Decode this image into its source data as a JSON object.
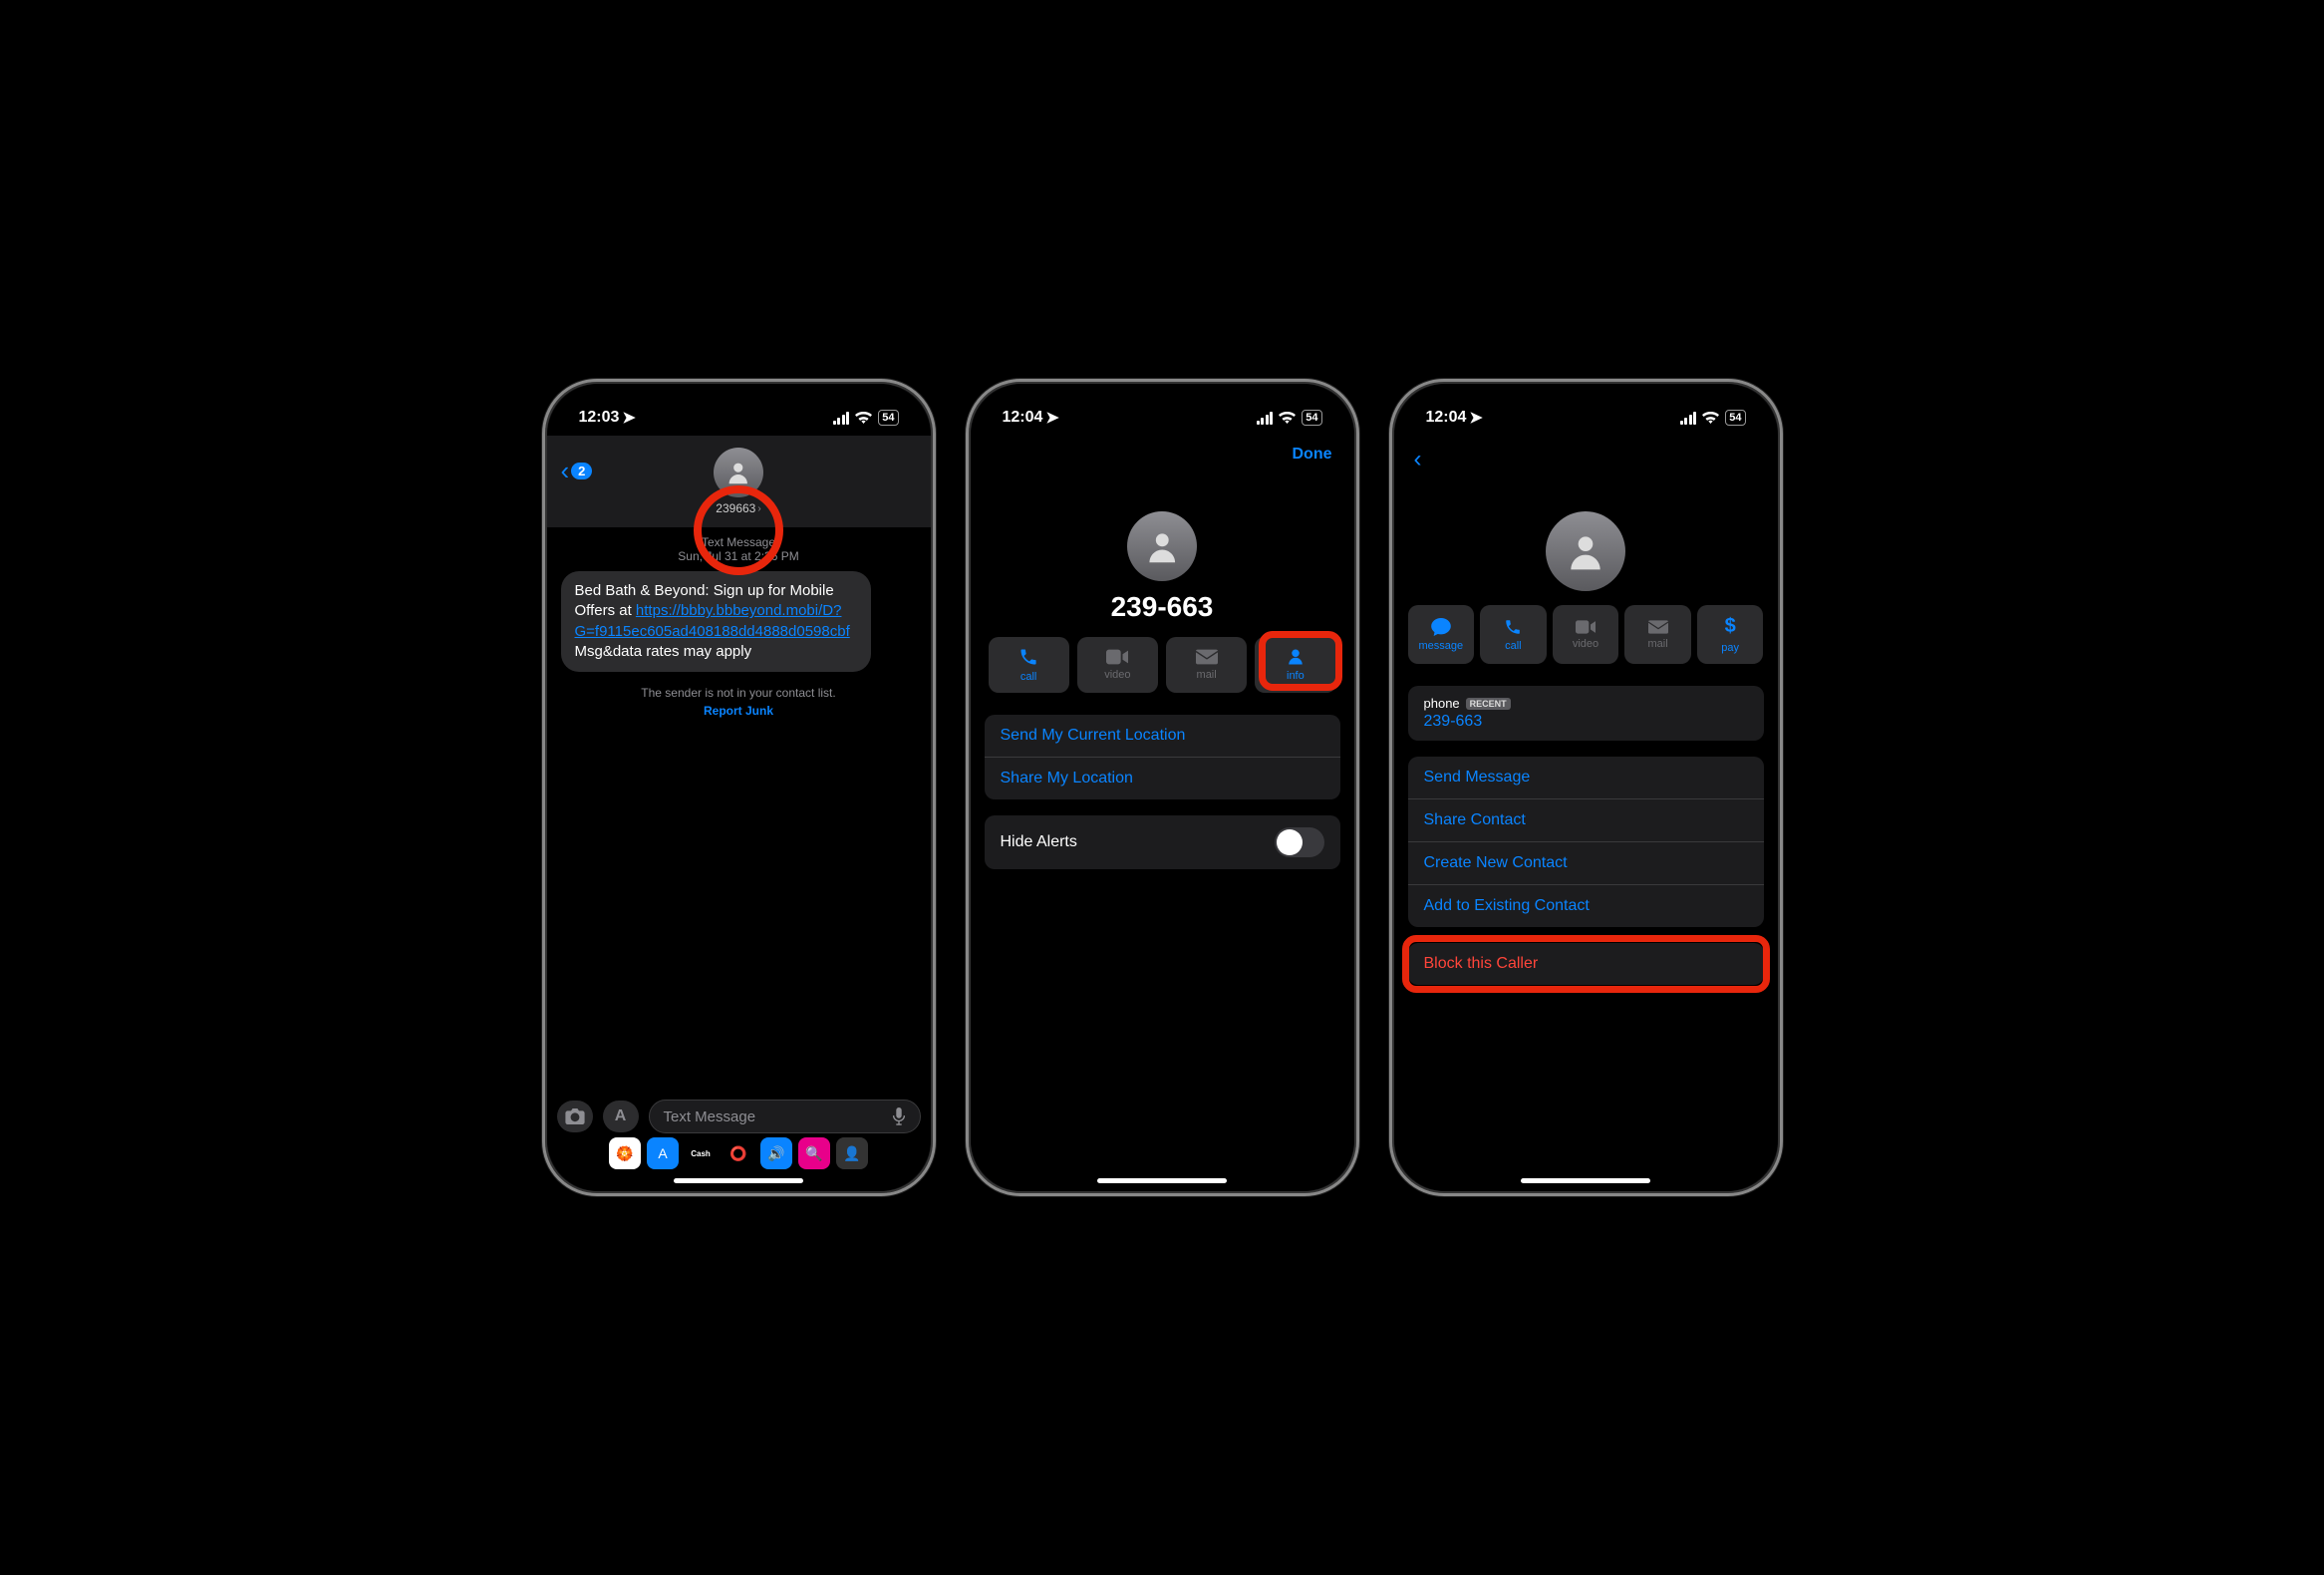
{
  "status": {
    "time1": "12:03",
    "time2": "12:04",
    "time3": "12:04",
    "battery": "54"
  },
  "phone1": {
    "back_badge": "2",
    "contact": "239663",
    "meta_type": "Text Message",
    "meta_date": "Sun, Jul 31 at 2:36 PM",
    "msg_text_pre": "Bed Bath & Beyond: Sign up for Mobile Offers at ",
    "msg_link": "https://bbby.bbbeyond.mobi/D?G=f9115ec605ad408188dd4888d0598cbf",
    "msg_text_post": " Msg&data rates may apply",
    "not_contact": "The sender is not in your contact list.",
    "report_junk": "Report Junk",
    "placeholder": "Text Message"
  },
  "phone2": {
    "done": "Done",
    "contact": "239-663",
    "actions": [
      {
        "label": "call",
        "state": "active"
      },
      {
        "label": "video",
        "state": "disabled"
      },
      {
        "label": "mail",
        "state": "disabled"
      },
      {
        "label": "info",
        "state": "active"
      }
    ],
    "send_loc": "Send My Current Location",
    "share_loc": "Share My Location",
    "hide_alerts": "Hide Alerts"
  },
  "phone3": {
    "actions": [
      {
        "label": "message",
        "state": "active"
      },
      {
        "label": "call",
        "state": "active"
      },
      {
        "label": "video",
        "state": "disabled"
      },
      {
        "label": "mail",
        "state": "disabled"
      },
      {
        "label": "pay",
        "state": "active"
      }
    ],
    "field_label": "phone",
    "recent_tag": "RECENT",
    "field_value": "239-663",
    "rows": [
      "Send Message",
      "Share Contact",
      "Create New Contact",
      "Add to Existing Contact"
    ],
    "block": "Block this Caller"
  }
}
